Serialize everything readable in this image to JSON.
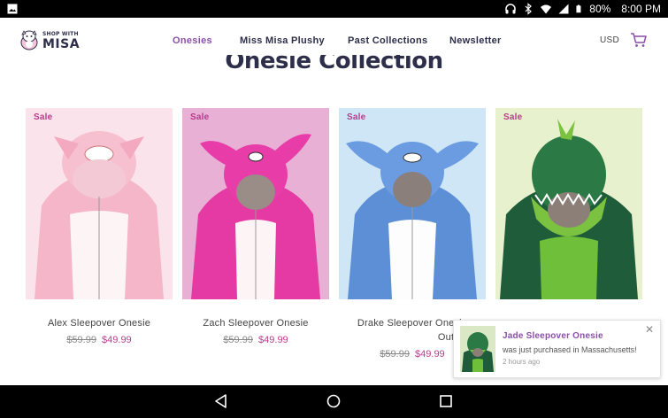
{
  "status_bar": {
    "battery": "80%",
    "time": "8:00 PM",
    "icons": [
      "image-icon",
      "headphones-icon",
      "bluetooth-icon",
      "wifi-icon",
      "signal-icon",
      "battery-icon"
    ]
  },
  "header": {
    "logo_top": "SHOP WITH",
    "logo_main": "MISA",
    "nav": [
      {
        "label": "Onesies",
        "active": true
      },
      {
        "label": "Miss Misa Plushy",
        "active": false
      },
      {
        "label": "Past Collections",
        "active": false
      },
      {
        "label": "Newsletter",
        "active": false
      }
    ],
    "currency": "USD",
    "cart_icon": "cart-icon"
  },
  "collection": {
    "title": "Onesie Collection",
    "products": [
      {
        "badge": "Sale",
        "name": "Alex Sleepover Onesie",
        "old_price": "$59.99",
        "price": "$49.99",
        "color": "pink-pig"
      },
      {
        "badge": "Sale",
        "name": "Zach Sleepover Onesie",
        "old_price": "$59.99",
        "price": "$49.99",
        "color": "magenta-bunny"
      },
      {
        "badge": "Sale",
        "name_line1": "Drake Sleepover Onesie",
        "name_line2": "Out)",
        "old_price": "$59.99",
        "price": "$49.99",
        "color": "blue-creature"
      },
      {
        "badge": "Sale",
        "name": "",
        "color": "green-dino"
      }
    ]
  },
  "notification": {
    "title": "Jade Sleepover Onesie",
    "message": "was just purchased in Massachusetts!",
    "time": "2 hours ago"
  },
  "colors": {
    "accent_purple": "#8a4fa8",
    "sale_pink": "#b83c8c",
    "navy": "#2d2f4a"
  }
}
